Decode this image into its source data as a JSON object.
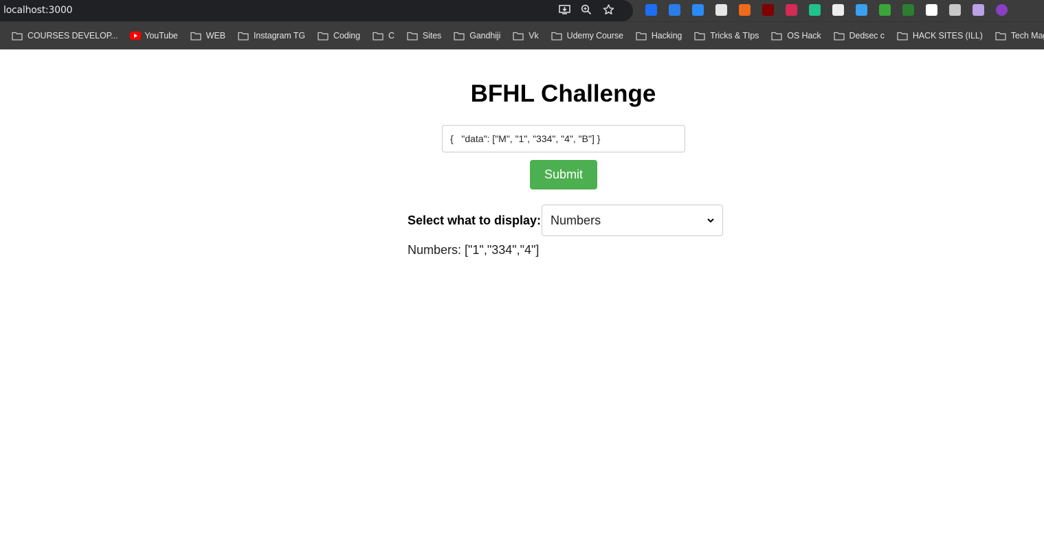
{
  "browser": {
    "url": "localhost:3000",
    "extensions": [
      {
        "name": "trello-ext-icon",
        "color": "#1d6ff2"
      },
      {
        "name": "shield-ext-icon",
        "color": "#2b7de9"
      },
      {
        "name": "blue-circle-ext-icon",
        "color": "#2a8af6"
      },
      {
        "name": "window-ext-icon",
        "color": "#e6e6e6"
      },
      {
        "name": "orange-ext-icon",
        "color": "#f06a1d"
      },
      {
        "name": "ublock-ext-icon",
        "color": "#800000"
      },
      {
        "name": "play-ext-icon",
        "color": "#d22b56"
      },
      {
        "name": "refresh-ext-icon",
        "color": "#1fc38b"
      },
      {
        "name": "glasses-ext-icon",
        "color": "#eeeeee"
      },
      {
        "name": "blue-square-ext-icon",
        "color": "#3aa0f0"
      },
      {
        "name": "music-ext-icon",
        "color": "#3ba53b"
      },
      {
        "name": "download-ext-icon",
        "color": "#2e7d32"
      },
      {
        "name": "info-ext-icon",
        "color": "#ffffff"
      },
      {
        "name": "joystick-ext-icon",
        "color": "#c8c8c8"
      },
      {
        "name": "mail-ext-icon",
        "color": "#b9a2e6"
      },
      {
        "name": "purple-ext-icon",
        "color": "#8a3ec2"
      }
    ],
    "bookmarks": [
      {
        "label": "COURSES DEVELOP...",
        "icon": "folder"
      },
      {
        "label": "YouTube",
        "icon": "youtube"
      },
      {
        "label": "WEB",
        "icon": "folder"
      },
      {
        "label": "Instagram TG",
        "icon": "folder"
      },
      {
        "label": "Coding",
        "icon": "folder"
      },
      {
        "label": "C",
        "icon": "folder"
      },
      {
        "label": "Sites",
        "icon": "folder"
      },
      {
        "label": "Gandhiji",
        "icon": "folder"
      },
      {
        "label": "Vk",
        "icon": "folder"
      },
      {
        "label": "Udemy Course",
        "icon": "folder"
      },
      {
        "label": "Hacking",
        "icon": "folder"
      },
      {
        "label": "Tricks & TIps",
        "icon": "folder"
      },
      {
        "label": "OS Hack",
        "icon": "folder"
      },
      {
        "label": "Dedsec c",
        "icon": "folder"
      },
      {
        "label": "HACK SITES (ILL)",
        "icon": "folder"
      },
      {
        "label": "Tech Mag.",
        "icon": "folder"
      }
    ]
  },
  "page": {
    "title": "BFHL Challenge",
    "json_input_value": "{   \"data\": [\"M\", \"1\", \"334\", \"4\", \"B\"] }",
    "submit_label": "Submit",
    "select_label": "Select what to display:",
    "select_value": "Numbers",
    "result_text": "Numbers: [\"1\",\"334\",\"4\"]",
    "submit_color": "#4caf50"
  }
}
